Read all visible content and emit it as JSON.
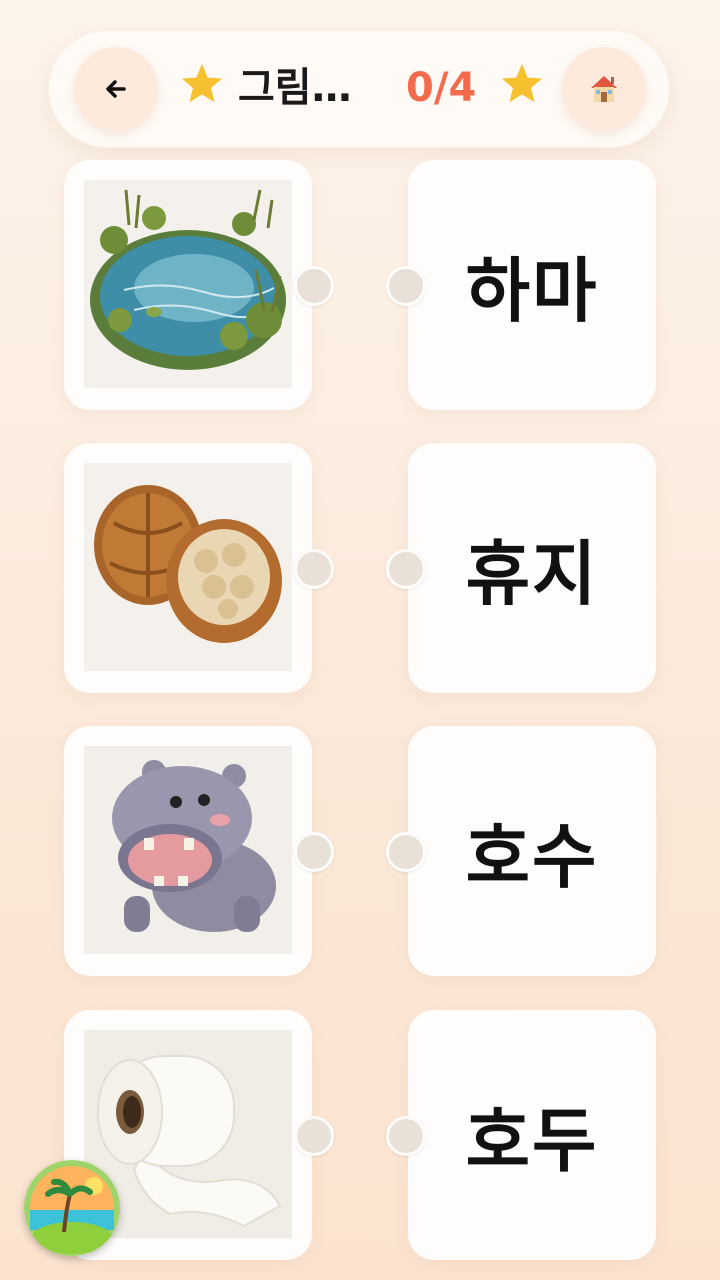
{
  "header": {
    "back_icon": "arrow-left-icon",
    "title": "그림…",
    "score": "0/4",
    "home_icon": "house-icon",
    "star_color": "#f5c12e",
    "score_color": "#f26b4c"
  },
  "images": [
    {
      "subject": "pond"
    },
    {
      "subject": "walnut"
    },
    {
      "subject": "hippo"
    },
    {
      "subject": "toilet-paper"
    }
  ],
  "words": [
    "하마",
    "휴지",
    "호수",
    "호두"
  ],
  "badge_icon": "island-logo-icon"
}
